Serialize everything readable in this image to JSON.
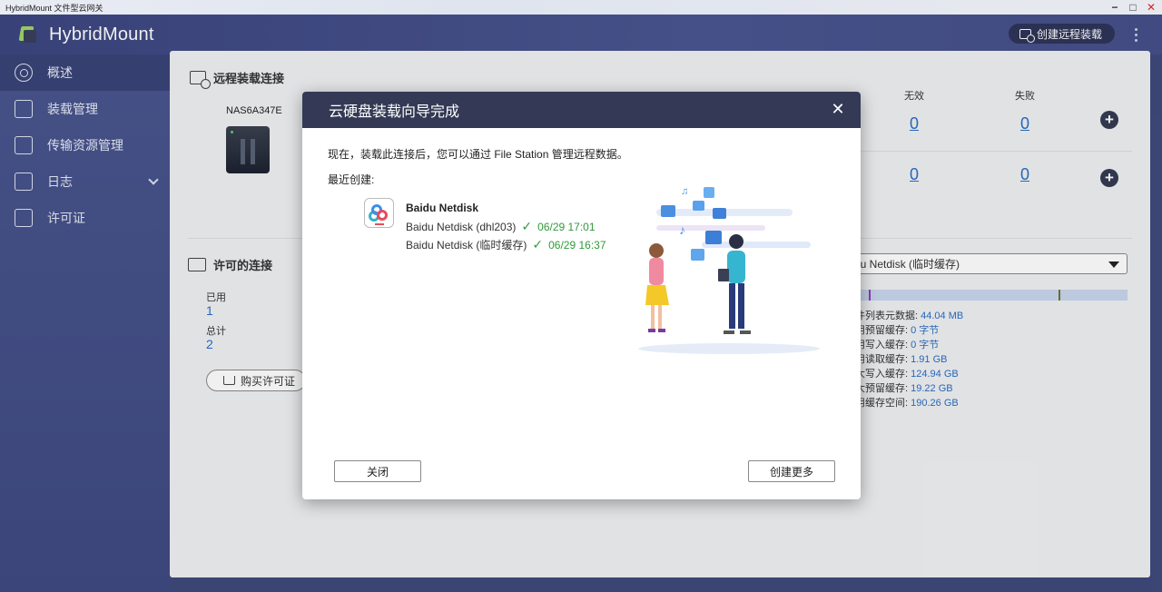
{
  "window": {
    "title": "HybridMount 文件型云网关",
    "controls": [
      "minimize",
      "maximize",
      "close"
    ]
  },
  "header": {
    "app_name": "HybridMount",
    "create_remote_mount_label": "创建远程装载"
  },
  "sidebar": {
    "items": [
      {
        "label": "概述",
        "icon": "overview-icon",
        "active": true
      },
      {
        "label": "装载管理",
        "icon": "mount-management-icon"
      },
      {
        "label": "传输资源管理",
        "icon": "transfer-resource-icon"
      },
      {
        "label": "日志",
        "icon": "log-icon",
        "expandable": true
      },
      {
        "label": "许可证",
        "icon": "license-icon"
      }
    ]
  },
  "main": {
    "remote_section_title": "远程装载连接",
    "nas_name": "NAS6A347E",
    "columns": {
      "invalid": "无效",
      "failed": "失败"
    },
    "rows": [
      {
        "invalid": "0",
        "failed": "0"
      },
      {
        "invalid": "0",
        "failed": "0"
      }
    ],
    "license_section_title": "许可的连接",
    "license": {
      "used_label": "已用",
      "used": "1",
      "total_label": "总计",
      "total": "2",
      "buy_label": "购买许可证"
    },
    "cache_select": "lu Netdisk (临时缓存)",
    "cache_bar": {
      "purple_marker_fraction": 0.05,
      "green_marker_fraction": 0.745
    },
    "stats": [
      {
        "label": "件列表元数据:",
        "value": "44.04 MB"
      },
      {
        "label": "用预留缓存:",
        "value": "0 字节"
      },
      {
        "label": "用写入缓存:",
        "value": "0 字节"
      },
      {
        "label": "用读取缓存:",
        "value": "1.91 GB"
      },
      {
        "label": "大写入缓存:",
        "value": "124.94 GB"
      },
      {
        "label": "大预留缓存:",
        "value": "19.22 GB"
      },
      {
        "label": "用缓存空间:",
        "value": "190.26 GB"
      }
    ]
  },
  "dialog": {
    "title": "云硬盘装载向导完成",
    "message": "现在，装载此连接后，您可以通过 File Station 管理远程数据。",
    "recent_label": "最近创建:",
    "service_name": "Baidu Netdisk",
    "entries": [
      {
        "name": "Baidu Netdisk (dhl203)",
        "time": "06/29 17:01"
      },
      {
        "name": "Baidu Netdisk (临时缓存)",
        "time": "06/29 16:37"
      }
    ],
    "close_label": "关闭",
    "create_more_label": "创建更多"
  },
  "colors": {
    "header": "#3c4780",
    "dialog_header": "#343a55",
    "link": "#2a6dc4",
    "success": "#2f9a3a"
  }
}
